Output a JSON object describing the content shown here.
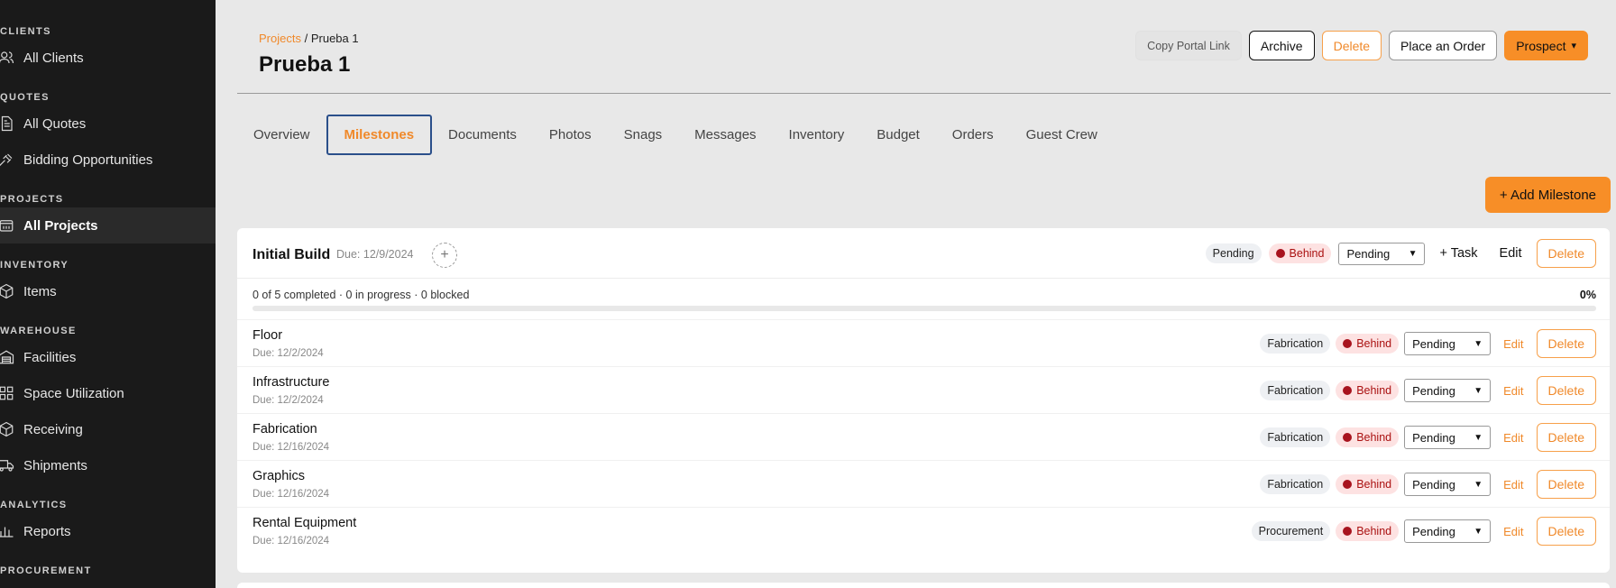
{
  "sidebar": {
    "sections": [
      {
        "label": "CLIENTS",
        "items": [
          {
            "label": "All Clients",
            "icon": "users-icon"
          }
        ]
      },
      {
        "label": "QUOTES",
        "items": [
          {
            "label": "All Quotes",
            "icon": "document-icon"
          },
          {
            "label": "Bidding Opportunities",
            "icon": "gavel-icon"
          }
        ]
      },
      {
        "label": "PROJECTS",
        "items": [
          {
            "label": "All Projects",
            "icon": "projects-icon"
          }
        ]
      },
      {
        "label": "INVENTORY",
        "items": [
          {
            "label": "Items",
            "icon": "box-icon"
          }
        ]
      },
      {
        "label": "WAREHOUSE",
        "items": [
          {
            "label": "Facilities",
            "icon": "warehouse-icon"
          },
          {
            "label": "Space Utilization",
            "icon": "grid-icon"
          },
          {
            "label": "Receiving",
            "icon": "box-icon"
          },
          {
            "label": "Shipments",
            "icon": "truck-icon"
          }
        ]
      },
      {
        "label": "ANALYTICS",
        "items": [
          {
            "label": "Reports",
            "icon": "bar-chart-icon"
          }
        ]
      },
      {
        "label": "PROCUREMENT",
        "items": []
      }
    ],
    "active_item": "All Projects"
  },
  "breadcrumb": {
    "parent": "Projects",
    "separator": "/",
    "current": "Prueba 1"
  },
  "page_title": "Prueba 1",
  "top_actions": {
    "copy_link": "Copy Portal Link",
    "archive": "Archive",
    "delete": "Delete",
    "place_order": "Place an Order",
    "status": "Prospect"
  },
  "tabs": [
    "Overview",
    "Milestones",
    "Documents",
    "Photos",
    "Snags",
    "Messages",
    "Inventory",
    "Budget",
    "Orders",
    "Guest Crew"
  ],
  "active_tab": "Milestones",
  "add_milestone": "+ Add Milestone",
  "milestone": {
    "title": "Initial Build",
    "due": "Due: 12/9/2024",
    "status_badge": "Pending",
    "behind_badge": "Behind",
    "status_select": "Pending",
    "add_task": "+ Task",
    "edit": "Edit",
    "delete": "Delete",
    "progress_text": "0 of 5 completed · 0 in progress · 0 blocked",
    "progress_pct": "0%",
    "progress_value": 0,
    "tasks": [
      {
        "name": "Floor",
        "due": "Due: 12/2/2024",
        "category": "Fabrication",
        "flag": "Behind",
        "status": "Pending",
        "edit": "Edit",
        "delete": "Delete"
      },
      {
        "name": "Infrastructure",
        "due": "Due: 12/2/2024",
        "category": "Fabrication",
        "flag": "Behind",
        "status": "Pending",
        "edit": "Edit",
        "delete": "Delete"
      },
      {
        "name": "Fabrication",
        "due": "Due: 12/16/2024",
        "category": "Fabrication",
        "flag": "Behind",
        "status": "Pending",
        "edit": "Edit",
        "delete": "Delete"
      },
      {
        "name": "Graphics",
        "due": "Due: 12/16/2024",
        "category": "Fabrication",
        "flag": "Behind",
        "status": "Pending",
        "edit": "Edit",
        "delete": "Delete"
      },
      {
        "name": "Rental Equipment",
        "due": "Due: 12/16/2024",
        "category": "Procurement",
        "flag": "Behind",
        "status": "Pending",
        "edit": "Edit",
        "delete": "Delete"
      }
    ]
  },
  "colors": {
    "accent": "#f78e27",
    "sidebar_bg": "#1a1a1a",
    "behind_dot": "#a8131e",
    "active_tab_border": "#2a4f8a"
  }
}
